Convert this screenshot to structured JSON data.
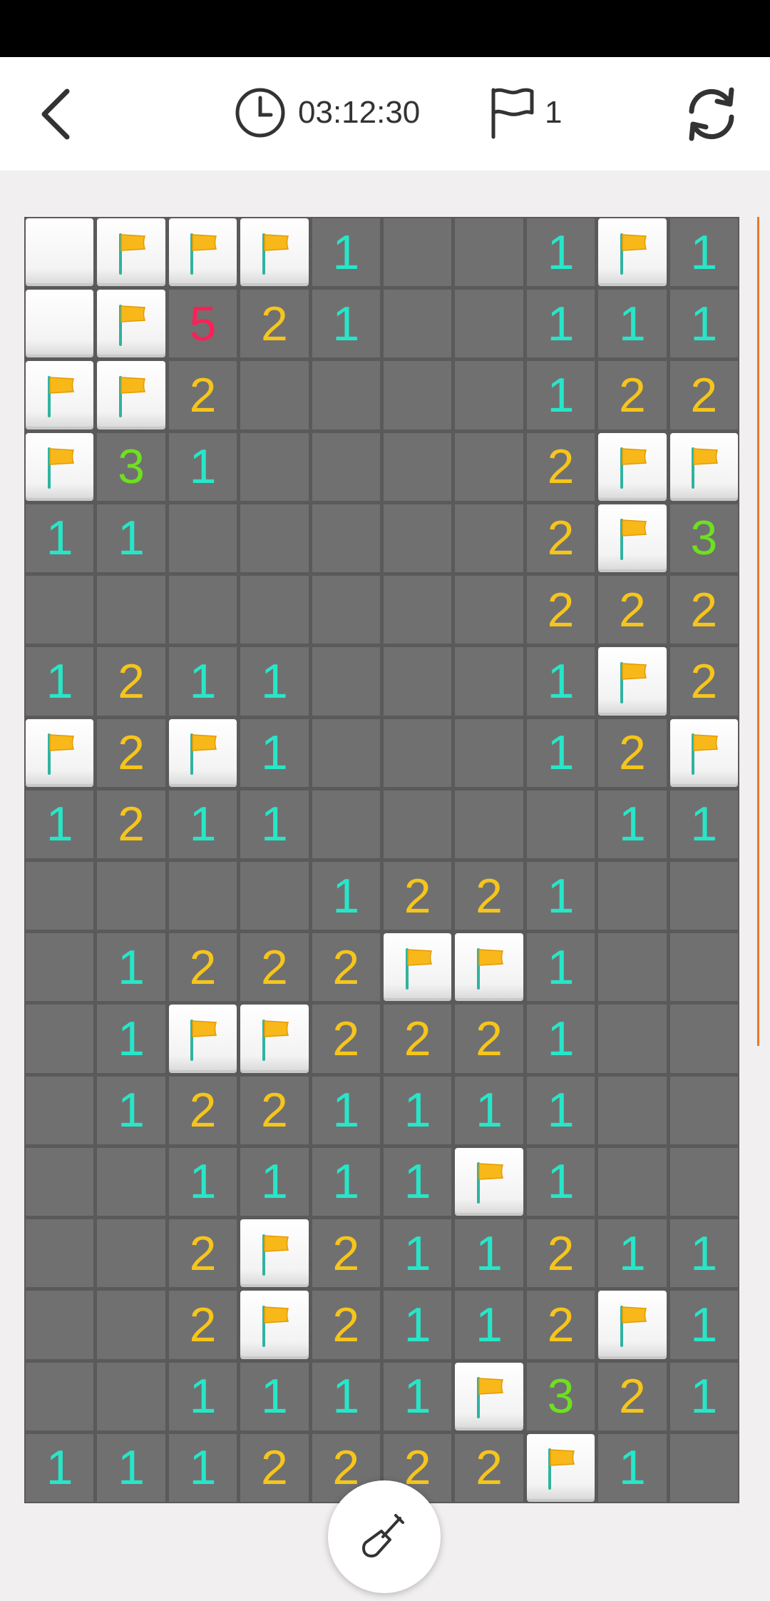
{
  "status_bar": {},
  "header": {
    "timer": "03:12:30",
    "flag_count": "1",
    "icons": {
      "back": "chevron-left-icon",
      "timer": "clock-icon",
      "flag": "flag-icon",
      "restart": "refresh-icon"
    }
  },
  "board": {
    "columns": 10,
    "rows": 18,
    "legend": "H = unrevealed tile, F = flagged tile, . = revealed empty, digit = revealed number",
    "grid": [
      [
        "H",
        "F",
        "F",
        "F",
        "1",
        ".",
        ".",
        "1",
        "F",
        "1"
      ],
      [
        "H",
        "F",
        "5",
        "2",
        "1",
        ".",
        ".",
        "1",
        "1",
        "1"
      ],
      [
        "F",
        "F",
        "2",
        ".",
        ".",
        ".",
        ".",
        "1",
        "2",
        "2"
      ],
      [
        "F",
        "3",
        "1",
        ".",
        ".",
        ".",
        ".",
        "2",
        "F",
        "F"
      ],
      [
        "1",
        "1",
        ".",
        ".",
        ".",
        ".",
        ".",
        "2",
        "F",
        "3"
      ],
      [
        ".",
        ".",
        ".",
        ".",
        ".",
        ".",
        ".",
        "2",
        "2",
        "2"
      ],
      [
        "1",
        "2",
        "1",
        "1",
        ".",
        ".",
        ".",
        "1",
        "F",
        "2"
      ],
      [
        "F",
        "2",
        "F",
        "1",
        ".",
        ".",
        ".",
        "1",
        "2",
        "F"
      ],
      [
        "1",
        "2",
        "1",
        "1",
        ".",
        ".",
        ".",
        ".",
        "1",
        "1"
      ],
      [
        ".",
        ".",
        ".",
        ".",
        "1",
        "2",
        "2",
        "1",
        ".",
        "."
      ],
      [
        ".",
        "1",
        "2",
        "2",
        "2",
        "F",
        "F",
        "1",
        ".",
        "."
      ],
      [
        ".",
        "1",
        "F",
        "F",
        "2",
        "2",
        "2",
        "1",
        ".",
        "."
      ],
      [
        ".",
        "1",
        "2",
        "2",
        "1",
        "1",
        "1",
        "1",
        ".",
        "."
      ],
      [
        ".",
        ".",
        "1",
        "1",
        "1",
        "1",
        "F",
        "1",
        ".",
        "."
      ],
      [
        ".",
        ".",
        "2",
        "F",
        "2",
        "1",
        "1",
        "2",
        "1",
        "1"
      ],
      [
        ".",
        ".",
        "2",
        "F",
        "2",
        "1",
        "1",
        "2",
        "F",
        "1"
      ],
      [
        ".",
        ".",
        "1",
        "1",
        "1",
        "1",
        "F",
        "3",
        "2",
        "1"
      ],
      [
        "1",
        "1",
        "1",
        "2",
        "2",
        "2",
        "2",
        "F",
        "1",
        "."
      ]
    ],
    "number_colors": {
      "1": "#27e6c8",
      "2": "#f6c51c",
      "3": "#6ee020",
      "5": "#ff1f57"
    }
  },
  "controls": {
    "dig_button_icon": "shovel-icon"
  },
  "colors": {
    "accent": "#e8782d",
    "board_background": "#5a5a5a",
    "revealed_tile": "#707070",
    "flag": "#f8b81a"
  }
}
